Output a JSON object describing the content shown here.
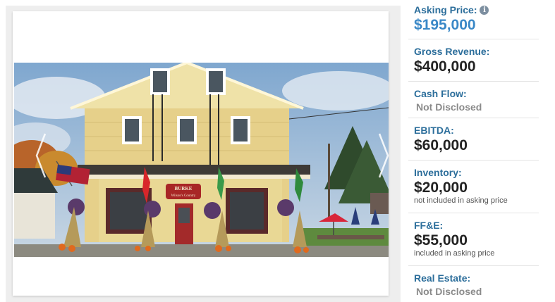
{
  "listing_photo": {
    "sign_line1": "BURKE",
    "sign_line2": "Wilson's Country"
  },
  "icons": {
    "info": "info-icon",
    "prev": "chevron-left-icon",
    "next": "chevron-right-icon"
  },
  "financials": {
    "asking_price": {
      "label": "Asking Price:",
      "value": "$195,000"
    },
    "gross_revenue": {
      "label": "Gross Revenue:",
      "value": "$400,000"
    },
    "cash_flow": {
      "label": "Cash Flow:",
      "value": "Not Disclosed"
    },
    "ebitda": {
      "label": "EBITDA:",
      "value": "$60,000"
    },
    "inventory": {
      "label": "Inventory:",
      "value": "$20,000",
      "note": "not included in asking price"
    },
    "ffe": {
      "label": "FF&E:",
      "value": "$55,000",
      "note": "included in asking price"
    },
    "real_estate": {
      "label": "Real Estate:",
      "value": "Not Disclosed"
    }
  },
  "colors": {
    "label": "#2c6e9b",
    "asking_price": "#3a88c7",
    "value": "#222222",
    "muted": "#8a8a8a",
    "building": "#e6d08a"
  }
}
